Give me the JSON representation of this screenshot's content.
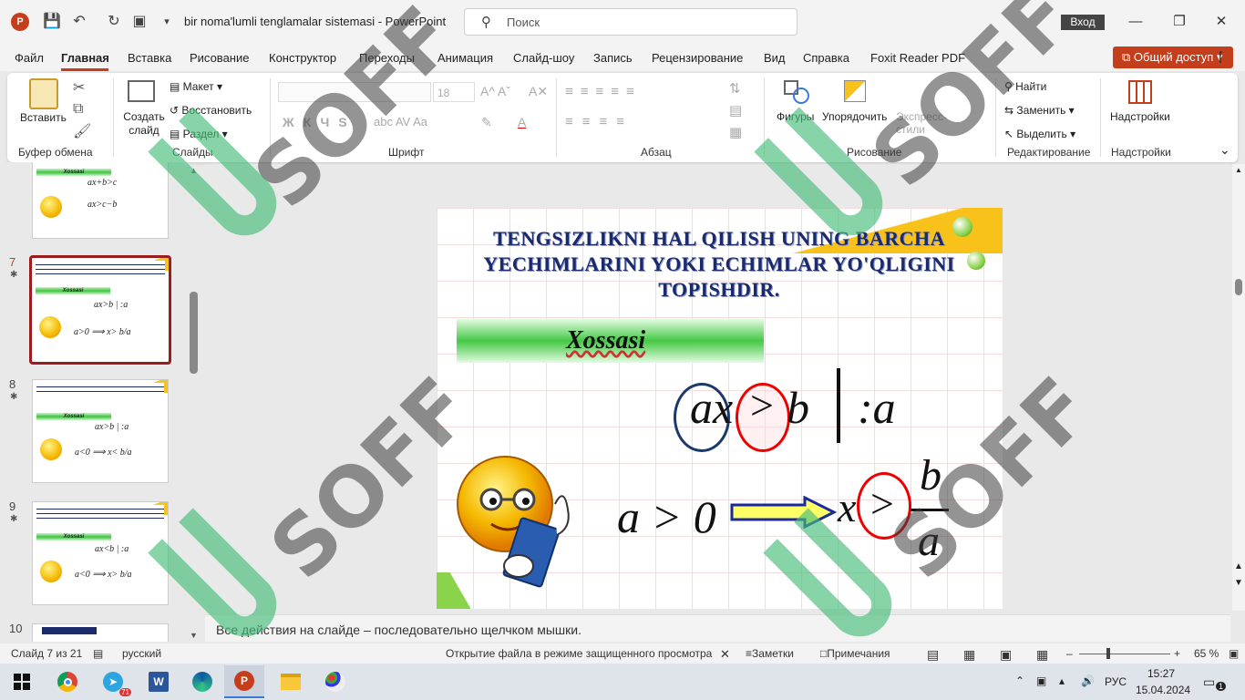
{
  "window": {
    "doc_title": "bir noma'lumli tenglamalar sistemasi  -  PowerPoint",
    "search_placeholder": "Поиск",
    "signin": "Вход"
  },
  "menu": [
    "Файл",
    "Главная",
    "Вставка",
    "Рисование",
    "Конструктор",
    "Переходы",
    "Анимация",
    "Слайд-шоу",
    "Запись",
    "Рецензирование",
    "Вид",
    "Справка",
    "Foxit Reader PDF"
  ],
  "share_label": "Общий доступ",
  "ribbon": {
    "paste": "Вставить",
    "new_slide": "Создать слайд",
    "layout": "Макет",
    "reset": "Восстановить",
    "section": "Раздел",
    "font_size": "18",
    "shapes": "Фигуры",
    "arrange": "Упорядочить",
    "quick_styles": "Экспресс-стили",
    "find": "Найти",
    "replace": "Заменить",
    "select": "Выделить",
    "addins": "Надстройки",
    "groups": {
      "clipboard": "Буфер обмена",
      "slides": "Слайды",
      "font": "Шрифт",
      "paragraph": "Абзац",
      "drawing": "Рисование",
      "editing": "Редактирование",
      "addins": "Надстройки"
    }
  },
  "thumbnails": [
    {
      "num": "",
      "formula1": "ax+b>c",
      "formula2": "ax>c−b",
      "bar": "Xossasi"
    },
    {
      "num": "7",
      "formula1": "ax>b | :a",
      "formula2": "a>0 ⟹ x> b/a",
      "bar": "Xossasi"
    },
    {
      "num": "8",
      "formula1": "ax>b | :a",
      "formula2": "a<0 ⟹ x< b/a",
      "bar": "Xossasi"
    },
    {
      "num": "9",
      "formula1": "ax<b | :a",
      "formula2": "a<0 ⟹ x> b/a",
      "bar": "Xossasi"
    },
    {
      "num": "10",
      "formula1": "",
      "formula2": "",
      "bar": ""
    }
  ],
  "slide": {
    "title": "TENGSIZLIKNI HAL QILISH UNING BARCHA YECHIMLARINI YOKI ECHIMLAR YO'QLIGINI TOPISHDIR.",
    "property": "Xossasi",
    "eq1_lhs_a": "ax",
    "eq1_op": ">",
    "eq1_rhs": "b",
    "eq1_div": ":a",
    "eq2_cond": "a > 0",
    "eq2_x": "x",
    "eq2_op": ">",
    "eq2_num": "b",
    "eq2_den": "a"
  },
  "notes": "Все действия на слайде – последовательно щелчком мышки.",
  "status": {
    "slide_info": "Слайд 7 из 21",
    "language": "русский",
    "protected": "Открытие файла в режиме защищенного просмотра",
    "notes_btn": "Заметки",
    "comments_btn": "Примечания",
    "zoom": "65 %"
  },
  "taskbar": {
    "language": "РУС",
    "time": "15:27",
    "date": "15.04.2024",
    "telegram_badge": "71",
    "notif_count": "1"
  },
  "watermark": "SOFF"
}
